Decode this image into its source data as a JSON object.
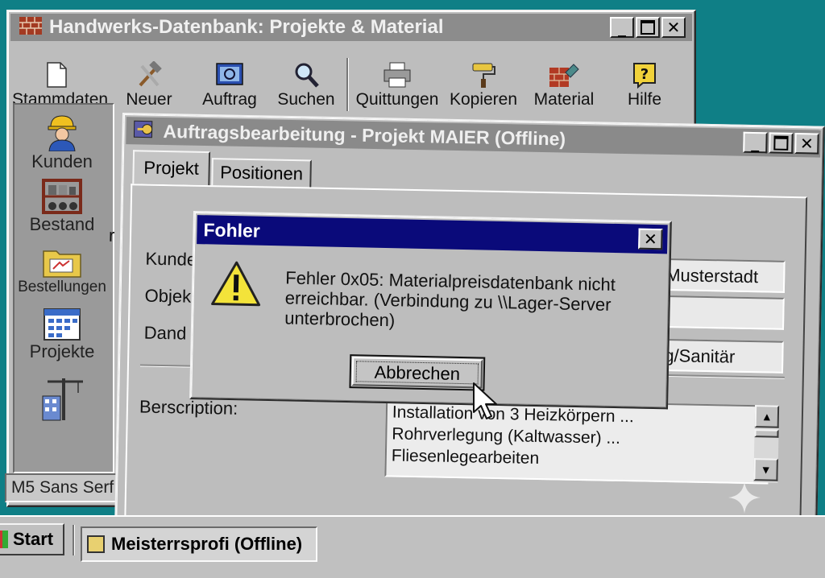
{
  "main_window": {
    "title": "Handwerks-Datenbank: Projekte & Material",
    "toolbar": [
      {
        "label": "Stammdaten",
        "icon": "document-icon"
      },
      {
        "label": "Neuer",
        "icon": "tools-icon"
      },
      {
        "label": "Auftrag",
        "icon": "picture-icon"
      },
      {
        "label": "Suchen",
        "icon": "magnifier-icon"
      },
      {
        "label": "Quittungen",
        "icon": "printer-icon"
      },
      {
        "label": "Kopieren",
        "icon": "paint-roller-icon"
      },
      {
        "label": "Material",
        "icon": "bricks-icon"
      },
      {
        "label": "Hilfe",
        "icon": "help-icon"
      }
    ],
    "sidebar": [
      {
        "label": "Kunden",
        "icon": "worker-icon"
      },
      {
        "label": "Bestand",
        "icon": "shelf-icon"
      },
      {
        "label": "Bestellungen",
        "icon": "folder-icon"
      },
      {
        "label": "Projekte",
        "icon": "calendar-icon"
      },
      {
        "label": "",
        "icon": "crane-icon"
      }
    ],
    "status_font": "M5 Sans Serf"
  },
  "order_window": {
    "title": "Auftragsbearbeitung - Projekt MAIER (Offline)",
    "tabs": [
      {
        "label": "Projekt",
        "active": true
      },
      {
        "label": "Positionen",
        "active": false
      }
    ],
    "labels": {
      "customer": "Kunde",
      "object": "Objek",
      "trade": "Dand",
      "description": "Berscription:"
    },
    "values": {
      "customer": "Musterstadt",
      "object": "",
      "trade": "g/Sanitär"
    },
    "description_lines": [
      "Installation von 3 Heizkörpern ...",
      "Rohrverlegung (Kaltwasser) ...",
      "Fliesenlegearbeiten"
    ],
    "stray_char": "r"
  },
  "dialog": {
    "title": "Fohler",
    "message_lines": [
      "Fehler 0x05: Materialpreisdatenbank nicht",
      "erreichbar. (Verbindung zu \\\\Lager-Server",
      "unterbrochen)"
    ],
    "button_label": "Abbrechen"
  },
  "taskbar": {
    "start_label": "Start",
    "task_label": "Meisterrsprofi (Offline)"
  },
  "colors": {
    "desktop": "#0f7f86",
    "dialog_title": "#0a0a7a",
    "inactive_title": "#8a8a8a"
  }
}
